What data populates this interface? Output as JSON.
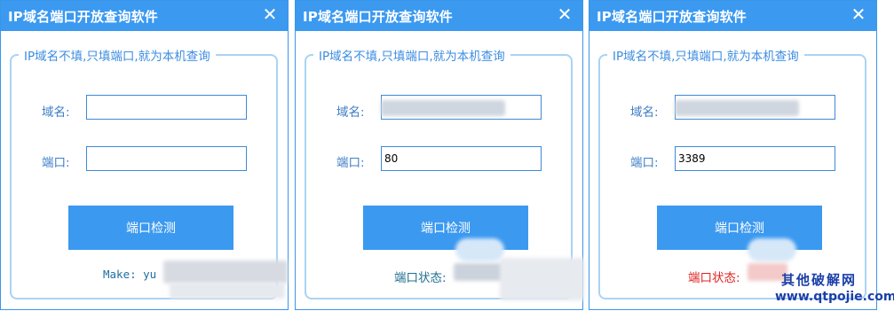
{
  "windows": [
    {
      "title": "IP域名端口开放查询软件",
      "close_glyph": "✕",
      "group_legend": "IP域名不填,只填端口,就为本机查询",
      "domain_label": "域名:",
      "domain_value": "",
      "port_label": "端口:",
      "port_value": "",
      "button_label": "端口检测",
      "status_text": "Make: yu"
    },
    {
      "title": "IP域名端口开放查询软件",
      "close_glyph": "✕",
      "group_legend": "IP域名不填,只填端口,就为本机查询",
      "domain_label": "域名:",
      "domain_value": "",
      "port_label": "端口:",
      "port_value": "80",
      "button_label": "端口检测",
      "status_text": "端口状态:"
    },
    {
      "title": "IP域名端口开放查询软件",
      "close_glyph": "✕",
      "group_legend": "IP域名不填,只填端口,就为本机查询",
      "domain_label": "域名:",
      "domain_value": "",
      "port_label": "端口:",
      "port_value": "3389",
      "button_label": "端口检测",
      "status_text": "端口状态:"
    }
  ],
  "colors": {
    "titlebar": "#3b99f0",
    "button": "#3b99f0",
    "label": "#3f7ec6",
    "status_default": "#1f6fa0",
    "status_open": "#1f6f8f",
    "status_closed": "#e02020"
  },
  "watermark": {
    "line1": "其他破解网",
    "line2": "www.qtpojie.com"
  }
}
